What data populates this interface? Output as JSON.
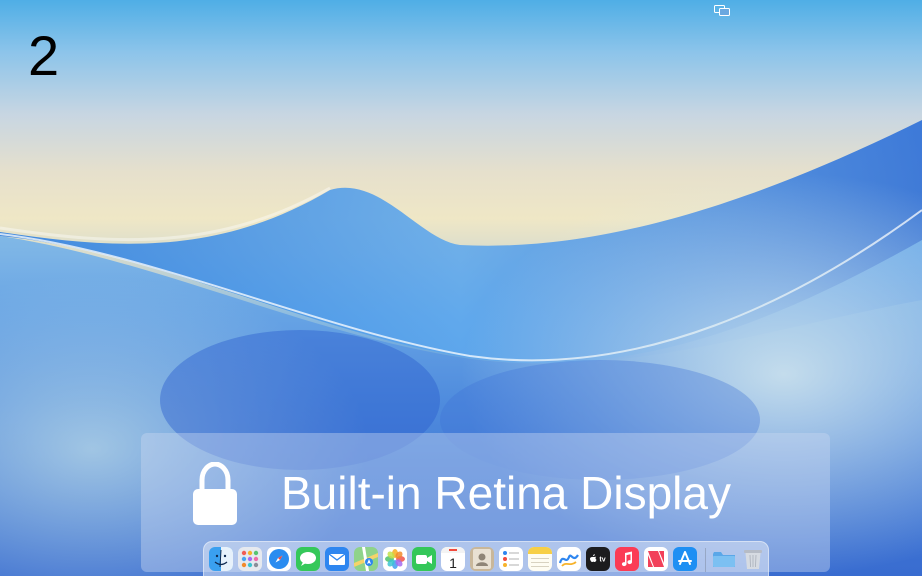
{
  "display": {
    "number": "2"
  },
  "banner": {
    "title": "Built-in Retina Display"
  },
  "menubar": {
    "icons": [
      "display-mirroring-icon"
    ]
  },
  "dock": {
    "apps": [
      {
        "name": "finder",
        "icon": "finder-icon"
      },
      {
        "name": "launchpad",
        "icon": "launchpad-icon"
      },
      {
        "name": "safari",
        "icon": "safari-icon"
      },
      {
        "name": "messages",
        "icon": "messages-icon"
      },
      {
        "name": "mail",
        "icon": "mail-icon"
      },
      {
        "name": "maps",
        "icon": "maps-icon"
      },
      {
        "name": "photos",
        "icon": "photos-icon"
      },
      {
        "name": "facetime",
        "icon": "facetime-icon"
      },
      {
        "name": "calendar",
        "icon": "calendar-icon",
        "day": "1"
      },
      {
        "name": "contacts",
        "icon": "contacts-icon"
      },
      {
        "name": "reminders",
        "icon": "reminders-icon"
      },
      {
        "name": "notes",
        "icon": "notes-icon"
      },
      {
        "name": "freeform",
        "icon": "freeform-icon"
      },
      {
        "name": "apple-tv",
        "icon": "apple-tv-icon",
        "label": "tv"
      },
      {
        "name": "music",
        "icon": "music-icon"
      },
      {
        "name": "news",
        "icon": "news-icon"
      },
      {
        "name": "app-store",
        "icon": "app-store-icon"
      }
    ],
    "extras": [
      {
        "name": "downloads-folder",
        "icon": "folder-icon"
      },
      {
        "name": "trash",
        "icon": "trash-icon"
      }
    ]
  },
  "colors": {
    "banner_text": "#ffffff",
    "display_number": "#000000"
  }
}
